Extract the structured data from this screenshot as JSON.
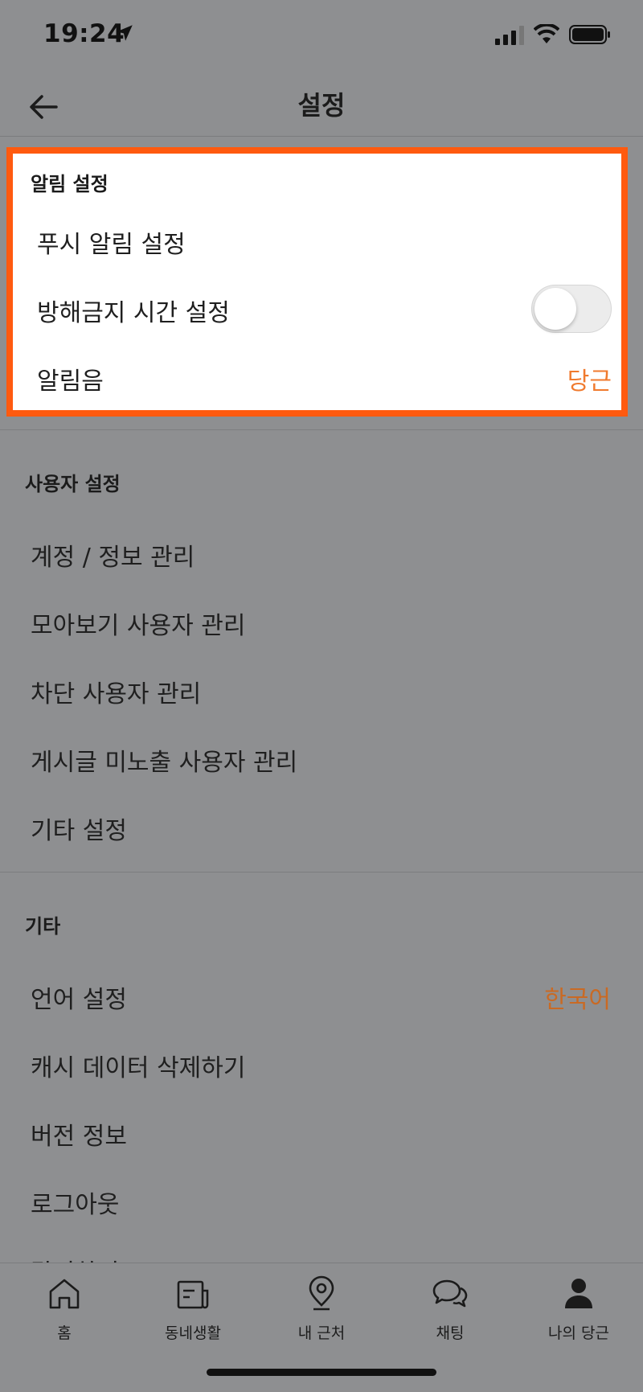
{
  "status_bar": {
    "time": "19:24"
  },
  "header": {
    "title": "설정"
  },
  "notification_section": {
    "label": "알림 설정",
    "items": [
      {
        "label": "푸시 알림 설정"
      },
      {
        "label": "방해금지 시간 설정",
        "toggle_on": false
      },
      {
        "label": "알림음",
        "value": "당근"
      }
    ]
  },
  "user_section": {
    "label": "사용자 설정",
    "items": [
      {
        "label": "계정 / 정보 관리"
      },
      {
        "label": "모아보기 사용자 관리"
      },
      {
        "label": "차단 사용자 관리"
      },
      {
        "label": "게시글 미노출 사용자 관리"
      },
      {
        "label": "기타 설정"
      }
    ]
  },
  "other_section": {
    "label": "기타",
    "items": [
      {
        "label": "언어 설정",
        "value": "한국어"
      },
      {
        "label": "캐시 데이터 삭제하기"
      },
      {
        "label": "버전 정보"
      },
      {
        "label": "로그아웃"
      },
      {
        "label": "탈퇴하기"
      }
    ]
  },
  "tabs": [
    {
      "label": "홈",
      "icon": "home-icon"
    },
    {
      "label": "동네생활",
      "icon": "neighborhood-icon"
    },
    {
      "label": "내 근처",
      "icon": "location-pin-icon"
    },
    {
      "label": "채팅",
      "icon": "chat-icon"
    },
    {
      "label": "나의 당근",
      "icon": "profile-icon"
    }
  ],
  "colors": {
    "accent": "#f07a2e",
    "highlight_border": "#ff5a0f",
    "overlay_background": "#8e8f91"
  }
}
